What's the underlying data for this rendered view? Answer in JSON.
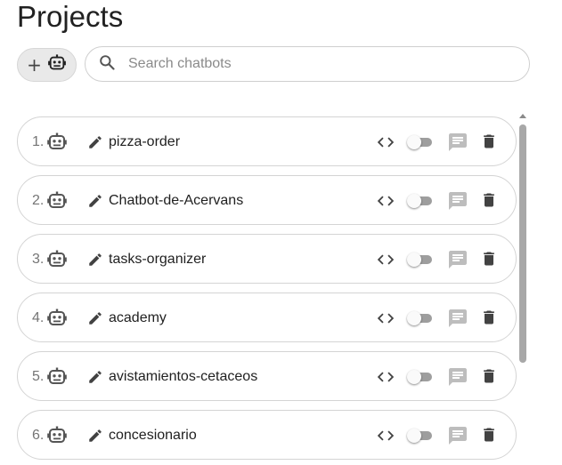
{
  "header": {
    "title": "Projects"
  },
  "toolbar": {
    "add_label": "+",
    "add_icon": "robot-icon"
  },
  "search": {
    "placeholder": "Search chatbots",
    "value": "",
    "icon": "search-icon"
  },
  "projects": [
    {
      "index": "1.",
      "name": "pizza-order",
      "enabled": false
    },
    {
      "index": "2.",
      "name": "Chatbot-de-Acervans",
      "enabled": false
    },
    {
      "index": "3.",
      "name": "tasks-organizer",
      "enabled": false
    },
    {
      "index": "4.",
      "name": "academy",
      "enabled": false
    },
    {
      "index": "5.",
      "name": "avistamientos-cetaceos",
      "enabled": false
    },
    {
      "index": "6.",
      "name": "concesionario",
      "enabled": false
    }
  ],
  "row_icons": {
    "bot": "robot-icon",
    "edit": "pencil-icon",
    "code": "code-icon",
    "chat": "chat-icon",
    "delete": "trash-icon"
  },
  "colors": {
    "icon": "#424242",
    "chat_icon_disabled": "#bdbdbd",
    "toggle_track": "#9e9e9e",
    "toggle_thumb": "#fafafa",
    "scrollbar_thumb": "#a8a8a8"
  }
}
